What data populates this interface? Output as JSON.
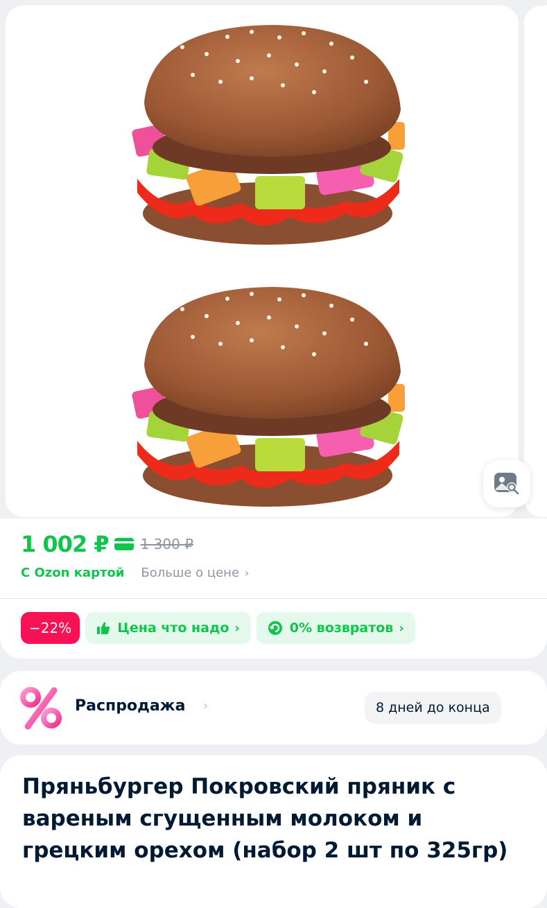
{
  "gallery": {
    "image_alt": "Пряньбургер Покровский пряник",
    "visual_search_icon": "image-search-icon"
  },
  "price": {
    "current": "1 002 ₽",
    "old": "1 300 ₽",
    "ozon_card_label": "С Ozon картой",
    "more_label": "Больше о цене",
    "accent_color": "#10c44c"
  },
  "badges": {
    "discount": "−22%",
    "good_price": "Цена что надо",
    "returns": "0% возвратов"
  },
  "sale": {
    "title": "Распродажа",
    "deadline": "8 дней до конца"
  },
  "product": {
    "title": "Пряньбургер Покровский пряник с вареным сгущенным молоком и грецким орехом (набор 2 шт по 325гр)"
  }
}
